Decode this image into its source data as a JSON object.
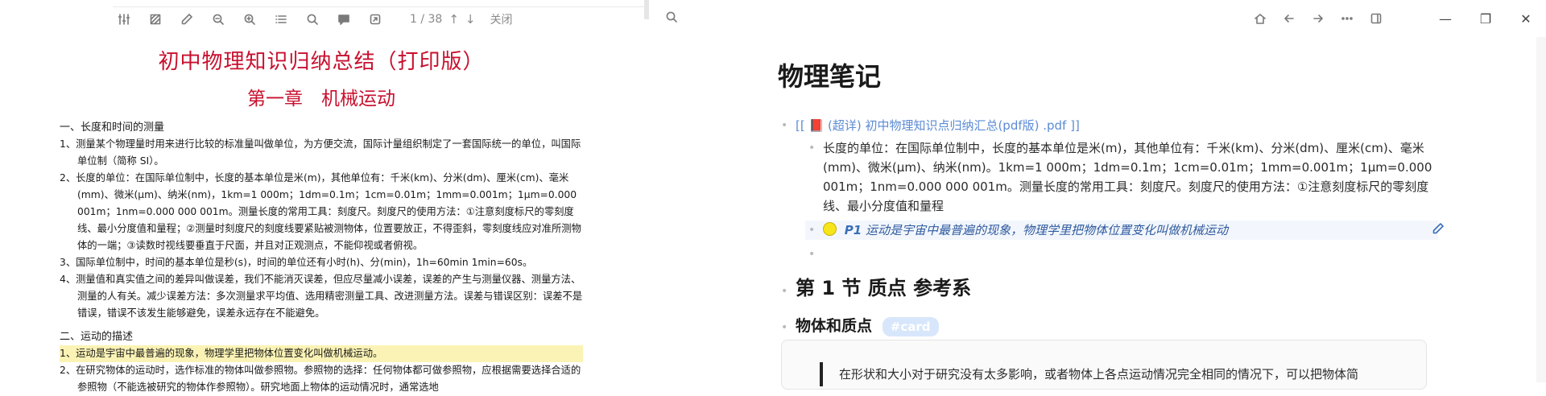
{
  "pdf_toolbar": {
    "icons": [
      "sliders-icon",
      "square-icon",
      "pen-icon",
      "zoom-out-icon",
      "zoom-in-icon",
      "list-icon",
      "search-icon",
      "comment-icon",
      "export-icon"
    ],
    "page_indicator": "1 / 38",
    "close_label": "关闭"
  },
  "pdf": {
    "title": "初中物理知识归纳总结（打印版）",
    "chapter": "第一章　机械运动",
    "sec1": "一、长度和时间的测量",
    "p1": "1、测量某个物理量时用来进行比较的标准量叫做单位，为方便交流，国际计量组织制定了一套国际统一的单位，叫国际单位制（简称 SI）。",
    "p2": "2、长度的单位：在国际单位制中，长度的基本单位是米(m)，其他单位有：千米(km)、分米(dm)、厘米(cm)、毫米(mm)、微米(μm)、纳米(nm)，1km=1 000m；1dm=0.1m；1cm=0.01m；1mm=0.001m；1μm=0.000 001m；1nm=0.000 000 001m。测量长度的常用工具：刻度尺。刻度尺的使用方法：①注意刻度标尺的零刻度线、最小分度值和量程；②测量时刻度尺的刻度线要紧贴被测物体，位置要放正，不得歪斜，零刻度线应对准所测物体的一端；③读数时视线要垂直于尺面，并且对正观测点，不能仰视或者俯视。",
    "p3": "3、国际单位制中，时间的基本单位是秒(s)，时间的单位还有小时(h)、分(min)，1h=60min 1min=60s。",
    "p4": "4、测量值和真实值之间的差异叫做误差，我们不能消灭误差，但应尽量减小误差，误差的产生与测量仪器、测量方法、测量的人有关。减少误差方法：多次测量求平均值、选用精密测量工具、改进测量方法。误差与错误区别：误差不是错误，错误不该发生能够避免，误差永远存在不能避免。",
    "sec2": "二、运动的描述",
    "p5": "1、运动是宇宙中最普遍的现象，物理学里把物体位置变化叫做机械运动。",
    "p6": "2、在研究物体的运动时，选作标准的物体叫做参照物。参照物的选择：任何物体都可做参照物，应根据需要选择合适的参照物（不能选被研究的物体作参照物）。研究地面上物体的运动情况时，通常选地"
  },
  "nav": {
    "icons": [
      "home-icon",
      "back-icon",
      "forward-icon",
      "more-icon",
      "sidebar-icon"
    ],
    "window": [
      "minimize-icon",
      "restore-icon",
      "close-icon"
    ]
  },
  "note": {
    "title": "物理笔记",
    "link_prefix": "[[",
    "link_text": "(超详) 初中物理知识点归纳汇总(pdf版) .pdf",
    "link_suffix": "]]",
    "para": "长度的单位：在国际单位制中，长度的基本单位是米(m)，其他单位有：千米(km)、分米(dm)、厘米(cm)、毫米(mm)、微米(μm)、纳米(nm)。1km=1 000m；1dm=0.1m；1cm=0.01m；1mm=0.001m；1μm=0.000 001m；1nm=0.000 000 001m。测量长度的常用工具：刻度尺。刻度尺的使用方法：①注意刻度标尺的零刻度线、最小分度值和量程",
    "annot_page": "P1",
    "annot_text": "运动是宇宙中最普遍的现象，物理学里把物体位置变化叫做机械运动",
    "h2": "第 1 节 质点 参考系",
    "h3": "物体和质点",
    "tag": "#card",
    "card_text": "在形状和大小对于研究没有太多影响，或者物体上各点运动情况完全相同的情况下，可以把物体简"
  },
  "colors": {
    "pdf_red": "#c8102e",
    "link_blue": "#5b8bd4",
    "tag_bg": "#d7e6fb"
  }
}
